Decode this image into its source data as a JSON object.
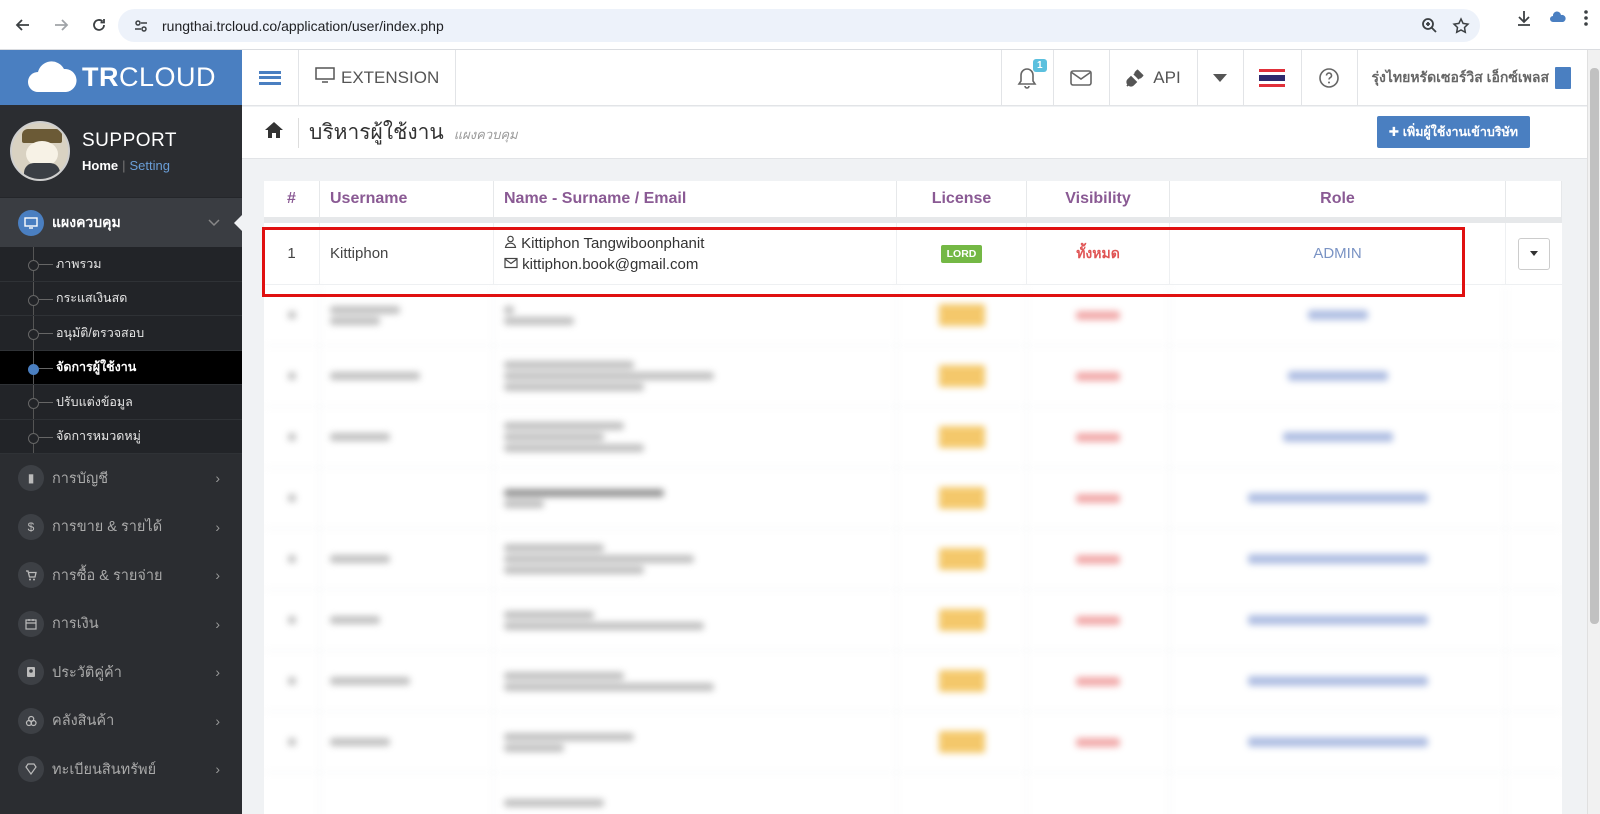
{
  "browser": {
    "url": "rungthai.trcloud.co/application/user/index.php"
  },
  "sidebar": {
    "brand": {
      "bold": "TR",
      "rest": "CLOUD"
    },
    "profile": {
      "name": "SUPPORT",
      "home": "Home",
      "sep": "|",
      "setting": "Setting"
    },
    "main_menu": {
      "label": "แผงควบคุม"
    },
    "sub_items": [
      {
        "label": "ภาพรวม"
      },
      {
        "label": "กระแสเงินสด"
      },
      {
        "label": "อนุมัติ/ตรวจสอบ"
      },
      {
        "label": "จัดการผู้ใช้งาน",
        "active": true
      },
      {
        "label": "ปรับแต่งข้อมูล"
      },
      {
        "label": "จัดการหมวดหมู่"
      }
    ],
    "menu_items": [
      {
        "label": "การบัญชี",
        "icon": "book-icon"
      },
      {
        "label": "การขาย & รายได้",
        "icon": "dollar-icon"
      },
      {
        "label": "การซื้อ & รายจ่าย",
        "icon": "cart-icon"
      },
      {
        "label": "การเงิน",
        "icon": "calendar-icon"
      },
      {
        "label": "ประวัติคู่ค้า",
        "icon": "contact-icon"
      },
      {
        "label": "คลังสินค้า",
        "icon": "boxes-icon"
      },
      {
        "label": "ทะเบียนสินทรัพย์",
        "icon": "diamond-icon"
      }
    ]
  },
  "topbar": {
    "extension_label": "EXTENSION",
    "notification_count": "1",
    "api_label": "API",
    "company": "รุ่งไทยหรัดเซอร์วิส เอ็กซ์เพลส"
  },
  "page": {
    "title": "บริหารผู้ใช้งาน",
    "subtitle": "แผงควบคุม",
    "add_button": "✚ เพิ่มผู้ใช้งานเข้าบริษัท"
  },
  "table": {
    "headers": [
      "#",
      "Username",
      "Name - Surname / Email",
      "License",
      "Visibility",
      "Role"
    ],
    "rows": [
      {
        "num": "1",
        "username": "Kittiphon",
        "name": "Kittiphon Tangwiboonphanit",
        "email": "kittiphon.book@gmail.com",
        "license": "LORD",
        "visibility": "ทั้งหมด",
        "role": "ADMIN"
      }
    ]
  },
  "colors": {
    "brand": "#4a7fc1",
    "sidebar_bg": "#2b2d31",
    "header_text": "#8a5a94",
    "license_green": "#74b845",
    "visibility_red": "#e05555",
    "highlight": "#e01010"
  }
}
